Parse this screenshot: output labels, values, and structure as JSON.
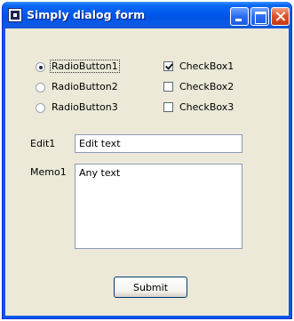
{
  "window": {
    "title": "Simply dialog form"
  },
  "radios": [
    {
      "label": "RadioButton1",
      "checked": true
    },
    {
      "label": "RadioButton2",
      "checked": false
    },
    {
      "label": "RadioButton3",
      "checked": false
    }
  ],
  "checkboxes": [
    {
      "label": "CheckBox1",
      "checked": true
    },
    {
      "label": "CheckBox2",
      "checked": false
    },
    {
      "label": "CheckBox3",
      "checked": false
    }
  ],
  "edit": {
    "label": "Edit1",
    "value": "Edit text"
  },
  "memo": {
    "label": "Memo1",
    "value": "Any text"
  },
  "submit": {
    "label": "Submit"
  },
  "colors": {
    "titlebar": "#0054e3",
    "window_bg": "#ece9d8",
    "close_button": "#e0542a"
  }
}
